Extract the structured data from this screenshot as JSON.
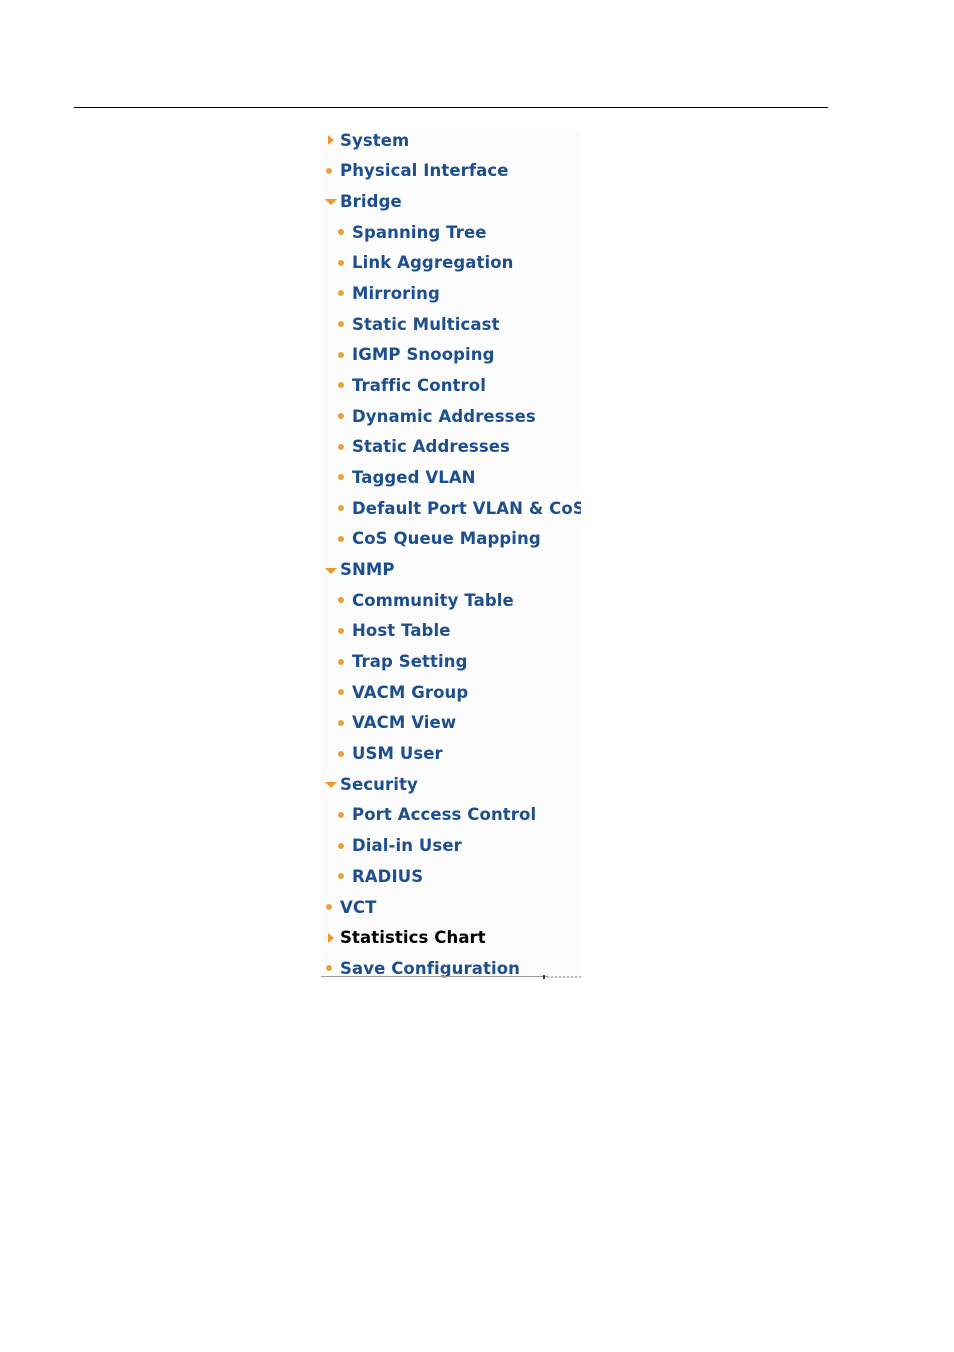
{
  "menu": {
    "items": [
      {
        "label": "System",
        "level": 0,
        "icon": "triangle-right-icon",
        "active": false
      },
      {
        "label": "Physical Interface",
        "level": 0,
        "icon": "bullet-icon",
        "active": false
      },
      {
        "label": "Bridge",
        "level": 0,
        "icon": "triangle-down-icon",
        "active": false
      },
      {
        "label": "Spanning Tree",
        "level": 1,
        "icon": "bullet-icon",
        "active": false
      },
      {
        "label": "Link Aggregation",
        "level": 1,
        "icon": "bullet-icon",
        "active": false
      },
      {
        "label": "Mirroring",
        "level": 1,
        "icon": "bullet-icon",
        "active": false
      },
      {
        "label": "Static Multicast",
        "level": 1,
        "icon": "bullet-icon",
        "active": false
      },
      {
        "label": "IGMP Snooping",
        "level": 1,
        "icon": "bullet-icon",
        "active": false
      },
      {
        "label": "Traffic Control",
        "level": 1,
        "icon": "bullet-icon",
        "active": false
      },
      {
        "label": "Dynamic Addresses",
        "level": 1,
        "icon": "bullet-icon",
        "active": false
      },
      {
        "label": "Static Addresses",
        "level": 1,
        "icon": "bullet-icon",
        "active": false
      },
      {
        "label": "Tagged VLAN",
        "level": 1,
        "icon": "bullet-icon",
        "active": false
      },
      {
        "label": "Default Port VLAN & CoS",
        "level": 1,
        "icon": "bullet-icon",
        "active": false
      },
      {
        "label": "CoS Queue Mapping",
        "level": 1,
        "icon": "bullet-icon",
        "active": false
      },
      {
        "label": "SNMP",
        "level": 0,
        "icon": "triangle-down-icon",
        "active": false
      },
      {
        "label": "Community Table",
        "level": 1,
        "icon": "bullet-icon",
        "active": false
      },
      {
        "label": "Host Table",
        "level": 1,
        "icon": "bullet-icon",
        "active": false
      },
      {
        "label": "Trap Setting",
        "level": 1,
        "icon": "bullet-icon",
        "active": false
      },
      {
        "label": "VACM Group",
        "level": 1,
        "icon": "bullet-icon",
        "active": false
      },
      {
        "label": "VACM View",
        "level": 1,
        "icon": "bullet-icon",
        "active": false
      },
      {
        "label": "USM User",
        "level": 1,
        "icon": "bullet-icon",
        "active": false
      },
      {
        "label": "Security",
        "level": 0,
        "icon": "triangle-down-icon",
        "active": false
      },
      {
        "label": "Port Access Control",
        "level": 1,
        "icon": "bullet-icon",
        "active": false
      },
      {
        "label": "Dial-in User",
        "level": 1,
        "icon": "bullet-icon",
        "active": false
      },
      {
        "label": "RADIUS",
        "level": 1,
        "icon": "bullet-icon",
        "active": false
      },
      {
        "label": "VCT",
        "level": 0,
        "icon": "bullet-icon",
        "active": false
      },
      {
        "label": "Statistics Chart",
        "level": 0,
        "icon": "triangle-right-icon",
        "active": true
      },
      {
        "label": "Save Configuration",
        "level": 0,
        "icon": "bullet-icon",
        "active": false
      }
    ]
  },
  "colors": {
    "link": "#1d4f8f",
    "active": "#000000",
    "icon": "#e8a13c"
  }
}
